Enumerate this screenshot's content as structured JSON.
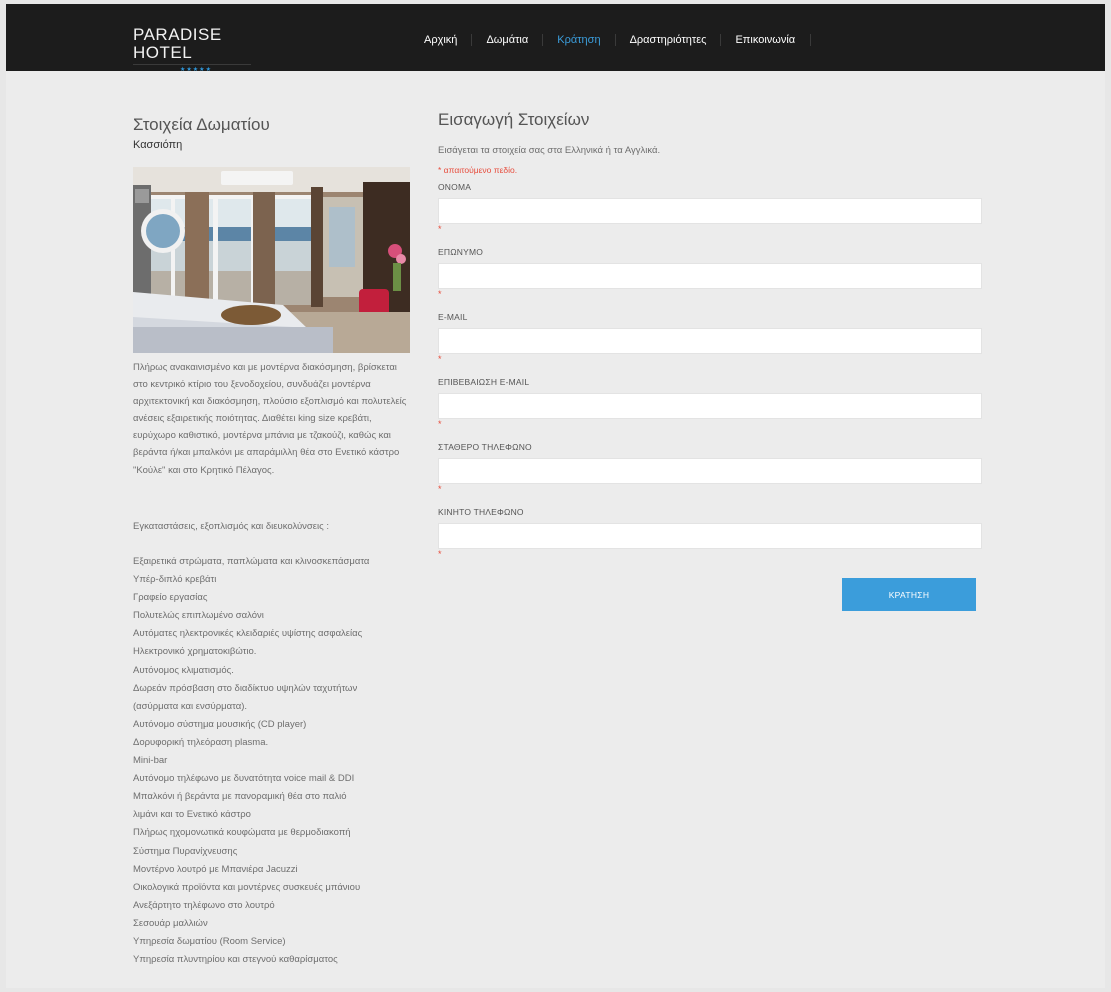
{
  "header": {
    "logo_text": "PARADISE HOTEL",
    "logo_stars": "★★★★★",
    "nav": [
      {
        "label": "Αρχική"
      },
      {
        "label": "Δωμάτια"
      },
      {
        "label": "Κράτηση"
      },
      {
        "label": "Δραστηριότητες"
      },
      {
        "label": "Επικοινωνία"
      }
    ],
    "active_nav": "Κράτηση",
    "accent_color": "#3b9ddb"
  },
  "room": {
    "section_title": "Στοιχεία Δωματίου",
    "name": "Κασσιόπη",
    "description": "Πλήρως ανακαινισμένο και με μοντέρνα διακόσμηση, βρίσκεται στο κεντρικό κτίριο του ξενοδοχείου, συνδυάζει μοντέρνα αρχιτεκτονική και διακόσμηση, πλούσιο εξοπλισμό και πολυτελείς ανέσεις εξαιρετικής ποιότητας. Διαθέτει king size κρεβάτι, ευρύχωρο καθιστικό, μοντέρνα μπάνια με τζακούζι, καθώς και βεράντα ή/και μπαλκόνι με απαράμιλλη θέα στο Ενετικό κάστρο \"Κούλε\" και στο Κρητικό Πέλαγος.",
    "amenities_heading": "Εγκαταστάσεις, εξοπλισμός και διευκολύνσεις :",
    "amenities": [
      "Εξαιρετικά στρώματα, παπλώματα και κλινοσκεπάσματα",
      "Υπέρ-διπλό κρεβάτι",
      "Γραφείο εργασίας",
      "Πολυτελώς επιπλωμένο σαλόνι",
      "Αυτόματες ηλεκτρονικές κλειδαριές υψίστης ασφαλείας",
      "Ηλεκτρονικό χρηματοκιβώτιο.",
      "Αυτόνομος κλιματισμός.",
      "Δωρεάν πρόσβαση στο διαδίκτυο υψηλών ταχυτήτων",
      "(ασύρματα και ενσύρματα).",
      "Αυτόνομο σύστημα μουσικής (CD player)",
      "Δορυφορική τηλεόραση plasma.",
      "Mini-bar",
      "Αυτόνομο τηλέφωνο με δυνατότητα voice mail & DDI",
      "Μπαλκόνι ή βεράντα με πανοραμική θέα στο παλιό",
      "λιμάνι και το Ενετικό κάστρο",
      "Πλήρως ηχομονωτικά κουφώματα με θερμοδιακοπή",
      "Σύστημα Πυρανίχνευσης",
      "Μοντέρνο λουτρό με Μπανιέρα Jacuzzi",
      "Οικολογικά προϊόντα και μοντέρνες συσκευές μπάνιου",
      "Ανεξάρτητο τηλέφωνο στο λουτρό",
      "Σεσουάρ μαλλιών",
      "Υπηρεσία δωματίου (Room Service)",
      "Υπηρεσία πλυντηρίου και στεγνού καθαρίσματος"
    ]
  },
  "form": {
    "title": "Εισαγωγή Στοιχείων",
    "instructions": "Εισάγεται τα στοιχεία σας στα Ελληνικά ή τα Αγγλικά.",
    "required_note": "* απαιτούμενο πεδίο.",
    "required_mark": "*",
    "required_color": "#e74c3c",
    "fields": [
      {
        "label": "ΟΝΟΜΑ",
        "value": ""
      },
      {
        "label": "ΕΠΩΝΥΜΟ",
        "value": ""
      },
      {
        "label": "E-MAIL",
        "value": ""
      },
      {
        "label": "ΕΠΙΒΕΒΑΙΩΣΗ E-MAIL",
        "value": ""
      },
      {
        "label": "ΣΤΑΘΕΡΟ ΤΗΛΕΦΩΝΟ",
        "value": ""
      },
      {
        "label": "ΚΙΝΗΤΟ ΤΗΛΕΦΩΝΟ",
        "value": ""
      }
    ],
    "submit_label": "ΚΡΑΤΗΣΗ"
  }
}
